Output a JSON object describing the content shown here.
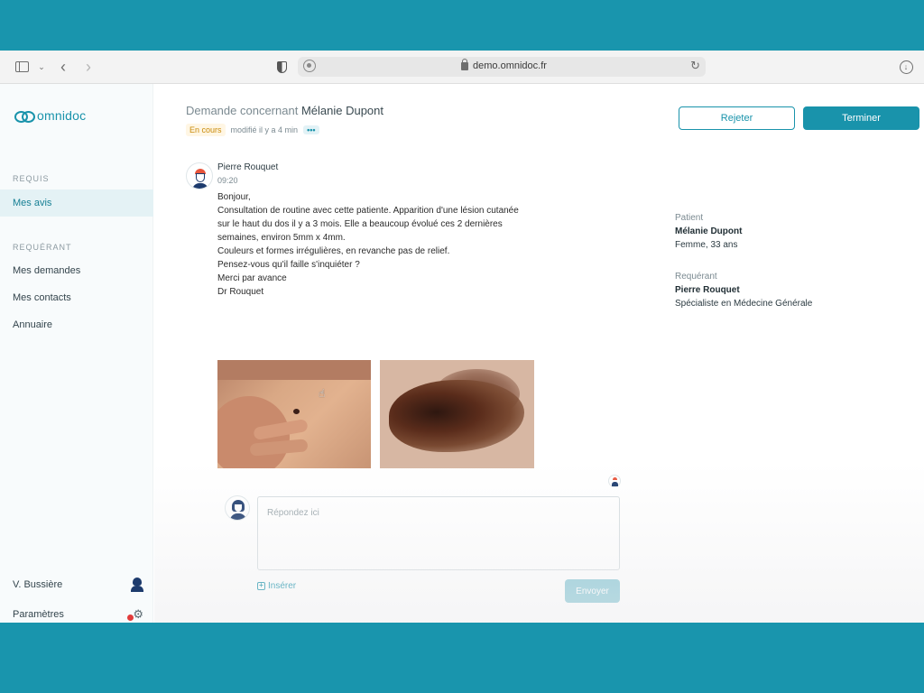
{
  "browser": {
    "url": "demo.omnidoc.fr"
  },
  "sidebar": {
    "logo_text": "omnidoc",
    "section_requis": "REQUIS",
    "item_mes_avis": "Mes avis",
    "section_requerant": "REQUÉRANT",
    "item_mes_demandes": "Mes demandes",
    "item_mes_contacts": "Mes contacts",
    "item_annuaire": "Annuaire",
    "user_name": "V. Bussière",
    "settings_label": "Paramètres"
  },
  "header": {
    "title_prefix": "Demande concernant",
    "title_name": "Mélanie Dupont",
    "status": "En cours",
    "modified": "modifié il y a 4 min",
    "more": "•••",
    "reject_label": "Rejeter",
    "finish_label": "Terminer"
  },
  "message": {
    "sender": "Pierre Rouquet",
    "time": "09:20",
    "lines": [
      "Bonjour,",
      "Consultation de routine avec cette patiente. Apparition d'une lésion cutanée",
      "sur le haut du dos il y a 3 mois. Elle a beaucoup évolué ces 2 dernières",
      "semaines, environ 5mm x 4mm.",
      "Couleurs et formes irrégulières, en revanche pas de relief.",
      "Pensez-vous qu'il faille s'inquiéter ?",
      "Merci par avance",
      "Dr Rouquet"
    ]
  },
  "reply": {
    "placeholder": "Répondez ici",
    "insert_label": "Insérer",
    "send_label": "Envoyer"
  },
  "info": {
    "patient_label": "Patient",
    "patient_name": "Mélanie Dupont",
    "patient_details": "Femme, 33 ans",
    "requester_label": "Requérant",
    "requester_name": "Pierre Rouquet",
    "requester_specialty": "Spécialiste en Médecine Générale"
  },
  "colors": {
    "accent": "#1993ab",
    "status": "#c98b0a",
    "background": "#1995ad"
  }
}
